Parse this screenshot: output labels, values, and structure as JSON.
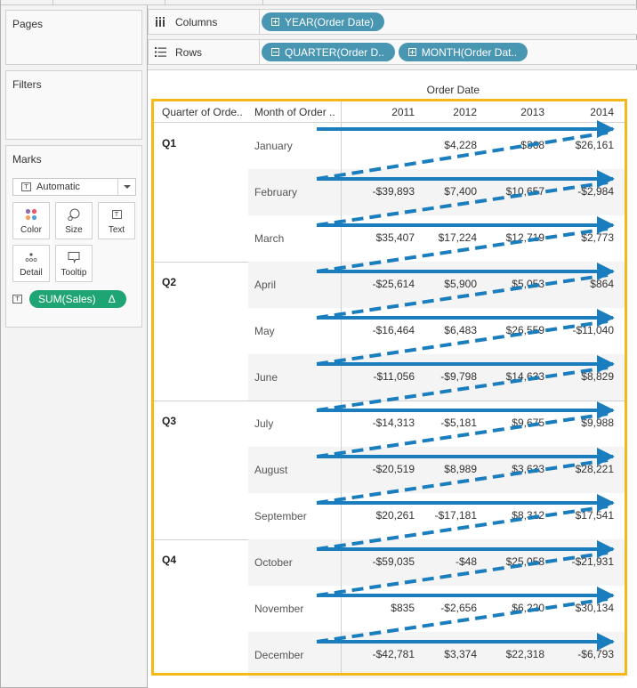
{
  "left_panel": {
    "pages_title": "Pages",
    "filters_title": "Filters",
    "marks": {
      "title": "Marks",
      "mark_type": "Automatic",
      "buttons": [
        {
          "label": "Color",
          "icon": "color-dots-icon"
        },
        {
          "label": "Size",
          "icon": "size-circles-icon"
        },
        {
          "label": "Text",
          "icon": "text-box-icon"
        },
        {
          "label": "Detail",
          "icon": "detail-dots-icon"
        },
        {
          "label": "Tooltip",
          "icon": "speech-bubble-icon"
        }
      ],
      "field_pill": {
        "label": "SUM(Sales)",
        "delta_symbol": "Δ",
        "color": "#1fa574"
      }
    }
  },
  "shelves": {
    "columns": {
      "label": "Columns",
      "icon_glyph": "iii",
      "pills": [
        {
          "label": "YEAR(Order Date)",
          "expand": "plus"
        }
      ]
    },
    "rows": {
      "label": "Rows",
      "icon_glyph": "☰",
      "pills": [
        {
          "label": "QUARTER(Order D..",
          "expand": "minus"
        },
        {
          "label": "MONTH(Order Dat..",
          "expand": "plus"
        }
      ]
    }
  },
  "view": {
    "column_group_title": "Order Date",
    "headers": {
      "quarter": "Quarter of Orde..",
      "month": "Month of Order ..",
      "years": [
        "2011",
        "2012",
        "2013",
        "2014"
      ]
    },
    "selection_color": "#f5b81b",
    "arrow_color": "#1a7dbe",
    "quarters": [
      {
        "label": "Q1",
        "months": [
          {
            "name": "January",
            "values": [
              "",
              "$4,228",
              "$368",
              "$26,161"
            ]
          },
          {
            "name": "February",
            "values": [
              "-$39,893",
              "$7,400",
              "$10,657",
              "-$2,984"
            ]
          },
          {
            "name": "March",
            "values": [
              "$35,407",
              "$17,224",
              "$12,719",
              "$2,773"
            ]
          }
        ]
      },
      {
        "label": "Q2",
        "months": [
          {
            "name": "April",
            "values": [
              "-$25,614",
              "$5,900",
              "$5,053",
              "$864"
            ]
          },
          {
            "name": "May",
            "values": [
              "-$16,464",
              "$6,483",
              "$26,559",
              "-$11,040"
            ]
          },
          {
            "name": "June",
            "values": [
              "-$11,056",
              "-$9,798",
              "$14,633",
              "$8,829"
            ]
          }
        ]
      },
      {
        "label": "Q3",
        "months": [
          {
            "name": "July",
            "values": [
              "-$14,313",
              "-$5,181",
              "$9,675",
              "$9,988"
            ]
          },
          {
            "name": "August",
            "values": [
              "-$20,519",
              "$8,989",
              "$3,633",
              "$28,221"
            ]
          },
          {
            "name": "September",
            "values": [
              "$20,261",
              "-$17,181",
              "$8,312",
              "$17,541"
            ]
          }
        ]
      },
      {
        "label": "Q4",
        "months": [
          {
            "name": "October",
            "values": [
              "-$59,035",
              "-$48",
              "$25,058",
              "-$21,931"
            ]
          },
          {
            "name": "November",
            "values": [
              "$835",
              "-$2,656",
              "$6,220",
              "$30,134"
            ]
          },
          {
            "name": "December",
            "values": [
              "-$42,781",
              "$3,374",
              "$22,318",
              "-$6,793"
            ]
          }
        ]
      }
    ]
  }
}
